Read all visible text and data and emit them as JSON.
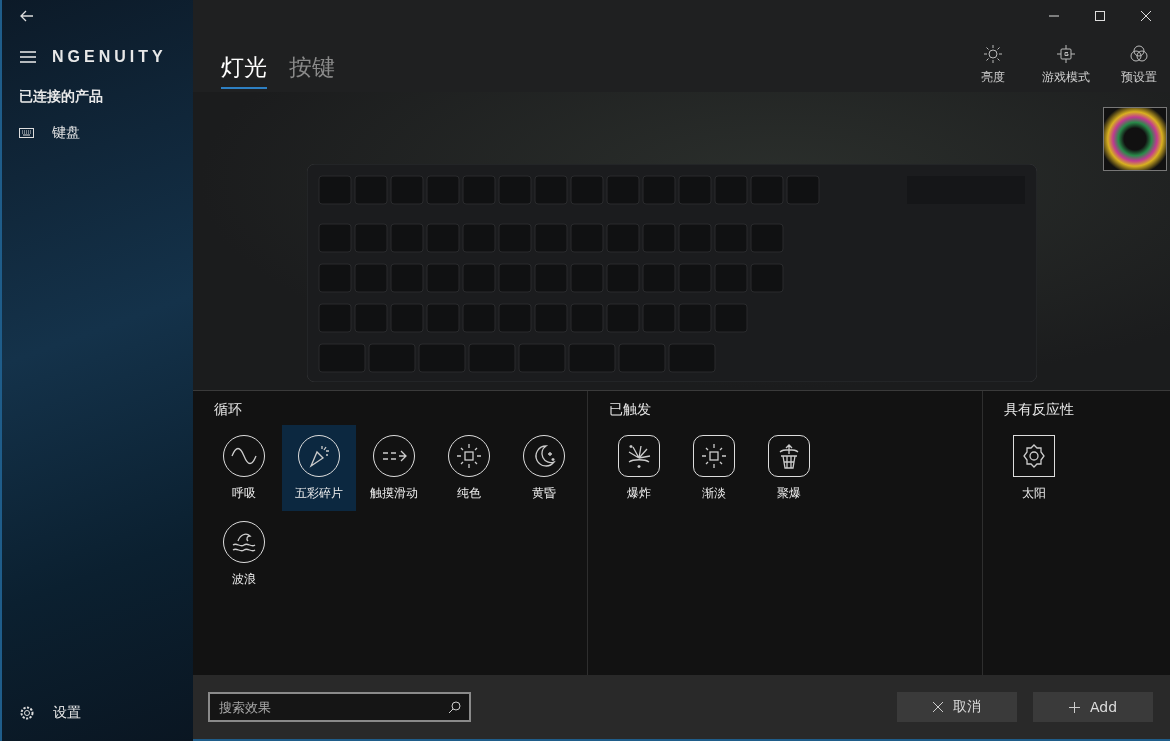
{
  "app": {
    "name": "NGENUITY"
  },
  "sidebar": {
    "heading": "已连接的产品",
    "items": [
      {
        "label": "键盘",
        "selected": false
      }
    ],
    "settings": "设置"
  },
  "tabs": [
    {
      "label": "灯光",
      "selected": true
    },
    {
      "label": "按键",
      "selected": false
    }
  ],
  "toolbar": [
    {
      "label": "亮度"
    },
    {
      "label": "游戏模式"
    },
    {
      "label": "预设置"
    }
  ],
  "effect_groups": [
    {
      "title": "循环",
      "kind": "circle",
      "items": [
        {
          "label": "呼吸",
          "selected": false
        },
        {
          "label": "五彩碎片",
          "selected": true
        },
        {
          "label": "触摸滑动",
          "selected": false
        },
        {
          "label": "纯色",
          "selected": false
        },
        {
          "label": "黄昏",
          "selected": false
        },
        {
          "label": "波浪",
          "selected": false
        }
      ]
    },
    {
      "title": "已触发",
      "kind": "rounded",
      "items": [
        {
          "label": "爆炸",
          "selected": false
        },
        {
          "label": "渐淡",
          "selected": false
        },
        {
          "label": "聚爆",
          "selected": false
        }
      ]
    },
    {
      "title": "具有反应性",
      "kind": "square",
      "items": [
        {
          "label": "太阳",
          "selected": false
        }
      ]
    }
  ],
  "search": {
    "placeholder": "搜索效果"
  },
  "buttons": [
    {
      "kind": "cancel",
      "label": "取消"
    },
    {
      "kind": "add",
      "label": "Add"
    }
  ]
}
